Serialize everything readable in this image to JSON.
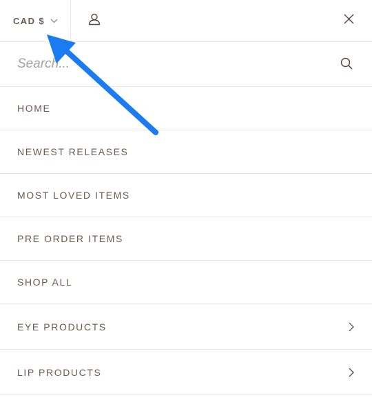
{
  "header": {
    "currency_label": "CAD $",
    "currency_icon": "chevron-down-icon",
    "account_icon": "user-icon",
    "close_icon": "close-icon"
  },
  "search": {
    "placeholder": "Search...",
    "icon": "search-icon"
  },
  "menu": {
    "items": [
      {
        "label": "HOME"
      },
      {
        "label": "NEWEST RELEASES"
      },
      {
        "label": "MOST LOVED ITEMS"
      },
      {
        "label": "PRE ORDER ITEMS"
      },
      {
        "label": "SHOP ALL"
      },
      {
        "label": "EYE PRODUCTS",
        "has_submenu": true
      },
      {
        "label": "LIP PRODUCTS",
        "has_submenu": true
      }
    ]
  },
  "annotation": {
    "arrow_color": "#1a7cf0"
  },
  "colors": {
    "text": "#6b5a50",
    "divider": "#e9e6e4",
    "placeholder": "#a8a09a"
  }
}
